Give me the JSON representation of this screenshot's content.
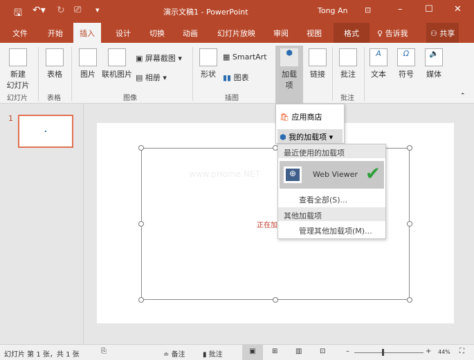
{
  "title_bar": {
    "document": "演示文稿1 - PowerPoint",
    "user": "Tong An"
  },
  "tabs": [
    "文件",
    "开始",
    "插入",
    "设计",
    "切换",
    "动画",
    "幻灯片放映",
    "审阅",
    "视图",
    "格式",
    "告诉我",
    "共享"
  ],
  "active_tab": "插入",
  "ribbon": {
    "new_slide": "新建\n幻灯片",
    "table": "表格",
    "picture": "图片",
    "online_picture": "联机图片",
    "screenshot": "屏幕截图",
    "album": "相册",
    "shapes": "形状",
    "smartart": "SmartArt",
    "chart": "图表",
    "addins": "加载\n项",
    "link": "链接",
    "comment": "批注",
    "text": "文本",
    "symbol": "符号",
    "media": "媒体",
    "groups": [
      "幻灯片",
      "表格",
      "图像",
      "插图",
      "批注"
    ]
  },
  "addin_menu": {
    "store": "应用商店",
    "my_addins": "我的加载项"
  },
  "my_addins_menu": {
    "recent_header": "最近使用的加载项",
    "recent_item": "Web Viewer",
    "view_all": "查看全部(S)...",
    "other_header": "其他加载项",
    "manage": "管理其他加载项(M)..."
  },
  "slide_panel": {
    "number": "1"
  },
  "slide": {
    "watermark": "www.pHome.NET",
    "loading": "正在加"
  },
  "status": {
    "slide_info": "幻灯片 第 1 张，共 1 张",
    "notes": "备注",
    "comments": "批注",
    "zoom": "44%"
  },
  "colors": {
    "accent": "#b7472a",
    "check": "#2e9e3a"
  }
}
